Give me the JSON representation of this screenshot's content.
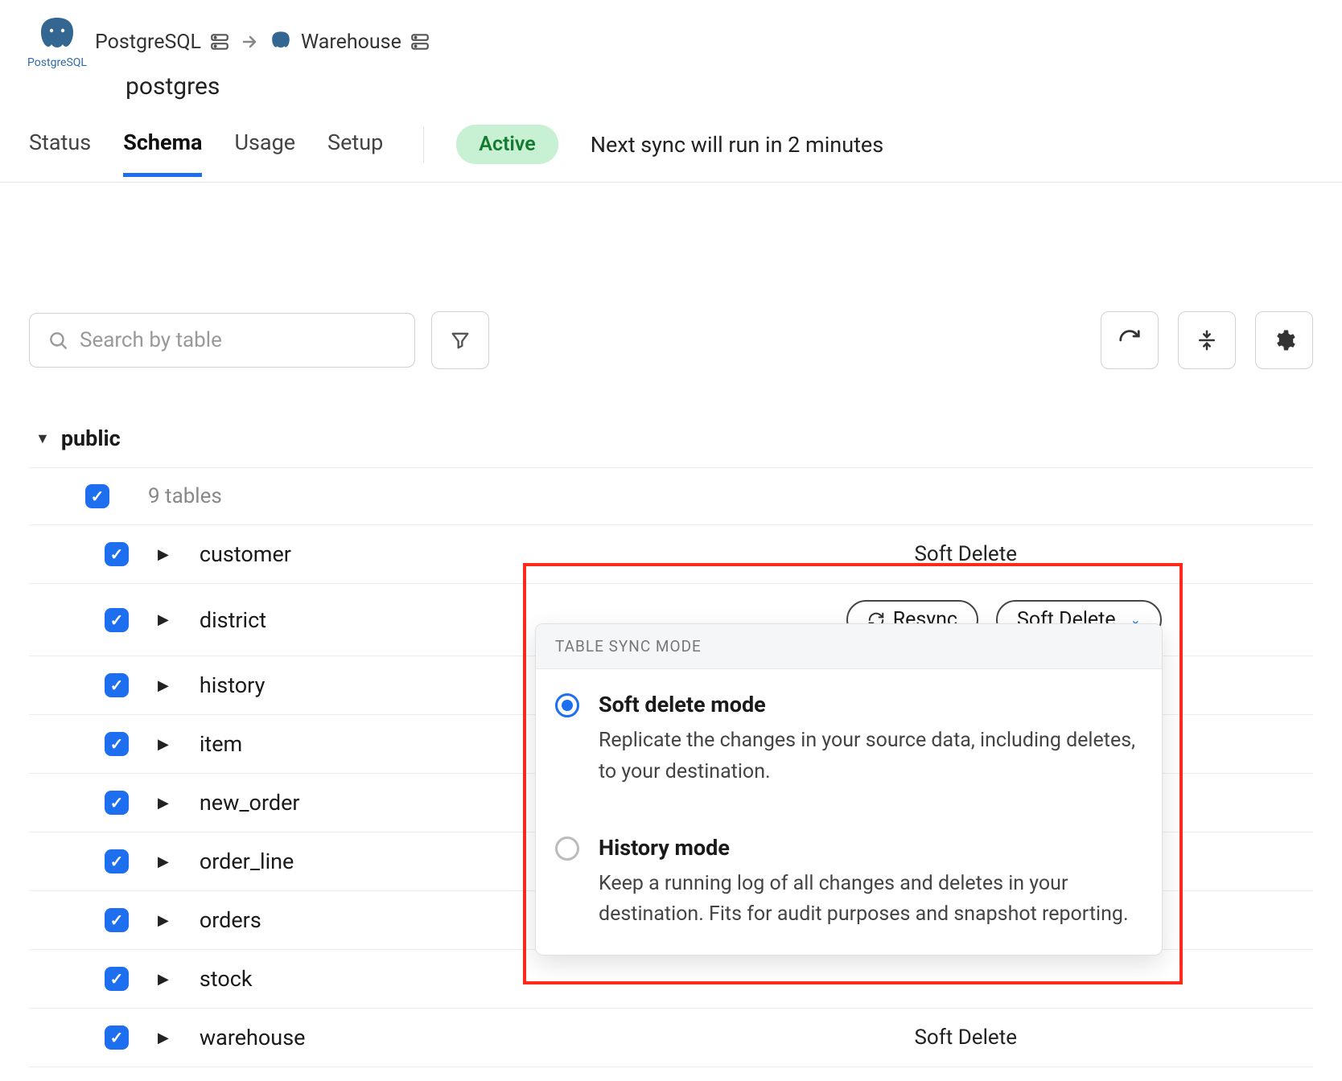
{
  "breadcrumb": {
    "source": "PostgreSQL",
    "destination": "Warehouse",
    "database": "postgres",
    "logo_label": "PostgreSQL"
  },
  "tabs": [
    "Status",
    "Schema",
    "Usage",
    "Setup"
  ],
  "active_tab": "Schema",
  "status_badge": "Active",
  "next_sync": "Next sync will run in 2 minutes",
  "search_placeholder": "Search by table",
  "schema": {
    "name": "public",
    "tables_summary": "9 tables",
    "tables": [
      {
        "name": "customer",
        "mode": "Soft Delete"
      },
      {
        "name": "district",
        "mode": "Soft Delete",
        "active": true
      },
      {
        "name": "history",
        "mode": ""
      },
      {
        "name": "item",
        "mode": ""
      },
      {
        "name": "new_order",
        "mode": ""
      },
      {
        "name": "order_line",
        "mode": ""
      },
      {
        "name": "orders",
        "mode": ""
      },
      {
        "name": "stock",
        "mode": ""
      },
      {
        "name": "warehouse",
        "mode": "Soft Delete"
      }
    ]
  },
  "row_actions": {
    "resync": "Resync",
    "mode_select": "Soft Delete"
  },
  "sync_mode_dropdown": {
    "header": "TABLE SYNC MODE",
    "options": [
      {
        "title": "Soft delete mode",
        "description": "Replicate the changes in your source data, including deletes, to your destination.",
        "selected": true
      },
      {
        "title": "History mode",
        "description": "Keep a running log of all changes and deletes in your destination. Fits for audit purposes and snapshot reporting.",
        "selected": false
      }
    ]
  }
}
